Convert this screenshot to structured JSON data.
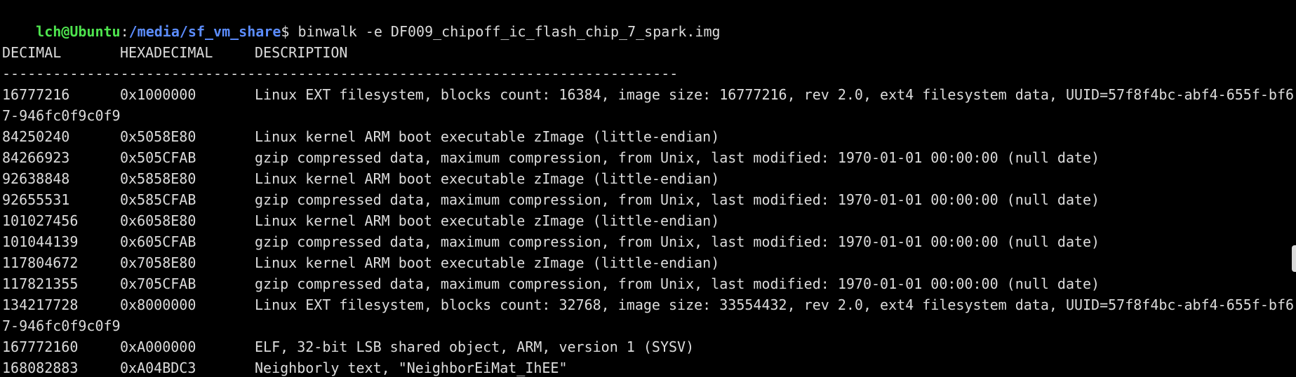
{
  "prompt": {
    "user_host": "lch@Ubuntu",
    "colon": ":",
    "cwd": "/media/sf_vm_share",
    "symbol": "$",
    "command": " binwalk -e DF009_chipoff_ic_flash_chip_7_spark.img"
  },
  "headers": {
    "decimal": "DECIMAL",
    "hexadecimal": "HEXADECIMAL",
    "description": "DESCRIPTION"
  },
  "separator": "--------------------------------------------------------------------------------",
  "rows": [
    {
      "decimal": "16777216",
      "hex": "0x1000000",
      "desc": "Linux EXT filesystem, blocks count: 16384, image size: 16777216, rev 2.0, ext4 filesystem data, UUID=57f8f4bc-abf4-655f-bf6",
      "cont": "7-946fc0f9c0f9"
    },
    {
      "decimal": "84250240",
      "hex": "0x5058E80",
      "desc": "Linux kernel ARM boot executable zImage (little-endian)"
    },
    {
      "decimal": "84266923",
      "hex": "0x505CFAB",
      "desc": "gzip compressed data, maximum compression, from Unix, last modified: 1970-01-01 00:00:00 (null date)"
    },
    {
      "decimal": "92638848",
      "hex": "0x5858E80",
      "desc": "Linux kernel ARM boot executable zImage (little-endian)"
    },
    {
      "decimal": "92655531",
      "hex": "0x585CFAB",
      "desc": "gzip compressed data, maximum compression, from Unix, last modified: 1970-01-01 00:00:00 (null date)"
    },
    {
      "decimal": "101027456",
      "hex": "0x6058E80",
      "desc": "Linux kernel ARM boot executable zImage (little-endian)"
    },
    {
      "decimal": "101044139",
      "hex": "0x605CFAB",
      "desc": "gzip compressed data, maximum compression, from Unix, last modified: 1970-01-01 00:00:00 (null date)"
    },
    {
      "decimal": "117804672",
      "hex": "0x7058E80",
      "desc": "Linux kernel ARM boot executable zImage (little-endian)"
    },
    {
      "decimal": "117821355",
      "hex": "0x705CFAB",
      "desc": "gzip compressed data, maximum compression, from Unix, last modified: 1970-01-01 00:00:00 (null date)"
    },
    {
      "decimal": "134217728",
      "hex": "0x8000000",
      "desc": "Linux EXT filesystem, blocks count: 32768, image size: 33554432, rev 2.0, ext4 filesystem data, UUID=57f8f4bc-abf4-655f-bf6",
      "cont": "7-946fc0f9c0f9"
    },
    {
      "decimal": "167772160",
      "hex": "0xA000000",
      "desc": "ELF, 32-bit LSB shared object, ARM, version 1 (SYSV)"
    },
    {
      "decimal": "168082883",
      "hex": "0xA04BDC3",
      "desc": "Neighborly text, \"NeighborEiMat_IhEE\""
    }
  ]
}
